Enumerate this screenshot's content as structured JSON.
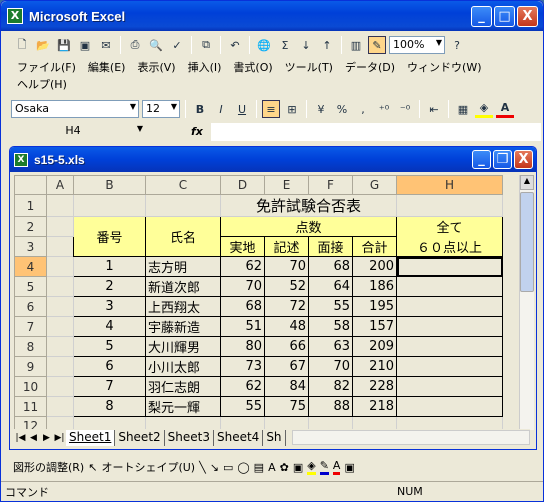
{
  "app": {
    "title": "Microsoft Excel",
    "icon": "X"
  },
  "window_buttons": {
    "min": "_",
    "max": "□",
    "close": "X"
  },
  "menu": [
    "ファイル(F)",
    "編集(E)",
    "表示(V)",
    "挿入(I)",
    "書式(O)",
    "ツール(T)",
    "データ(D)",
    "ウィンドウ(W)",
    "ヘルプ(H)"
  ],
  "toolbar": {
    "zoom": "100%",
    "sigma": "Σ"
  },
  "format": {
    "font": "Osaka",
    "size": "12",
    "bold": "B",
    "italic": "I",
    "underline": "U",
    "currency": "¥",
    "percent": "%",
    "comma": ","
  },
  "namebox": "H4",
  "fx": "fx",
  "workbook": {
    "title": "s15-5.xls"
  },
  "columns": [
    "A",
    "B",
    "C",
    "D",
    "E",
    "F",
    "G",
    "H"
  ],
  "rows": [
    "1",
    "2",
    "3",
    "4",
    "5",
    "6",
    "7",
    "8",
    "9",
    "10",
    "11",
    "12"
  ],
  "sheet": {
    "title": "免許試験合否表",
    "h_number": "番号",
    "h_name": "氏名",
    "h_score": "点数",
    "h_sub": [
      "実地",
      "記述",
      "面接",
      "合計"
    ],
    "h_all1": "全て",
    "h_all2": "６０点以上",
    "records": [
      [
        "1",
        "志方明",
        "62",
        "70",
        "68",
        "200"
      ],
      [
        "2",
        "新道次郎",
        "70",
        "52",
        "64",
        "186"
      ],
      [
        "3",
        "上西翔太",
        "68",
        "72",
        "55",
        "195"
      ],
      [
        "4",
        "宇藤新造",
        "51",
        "48",
        "58",
        "157"
      ],
      [
        "5",
        "大川輝男",
        "80",
        "66",
        "63",
        "209"
      ],
      [
        "6",
        "小川太郎",
        "73",
        "67",
        "70",
        "210"
      ],
      [
        "7",
        "羽仁志朗",
        "62",
        "84",
        "82",
        "228"
      ],
      [
        "8",
        "梨元一輝",
        "55",
        "75",
        "88",
        "218"
      ]
    ]
  },
  "tabs": [
    "Sheet1",
    "Sheet2",
    "Sheet3",
    "Sheet4",
    "Sh"
  ],
  "drawing": {
    "adjust": "図形の調整(R)",
    "autoshape": "オートシェイプ(U)"
  },
  "status": {
    "mode": "コマンド",
    "num": "NUM"
  }
}
